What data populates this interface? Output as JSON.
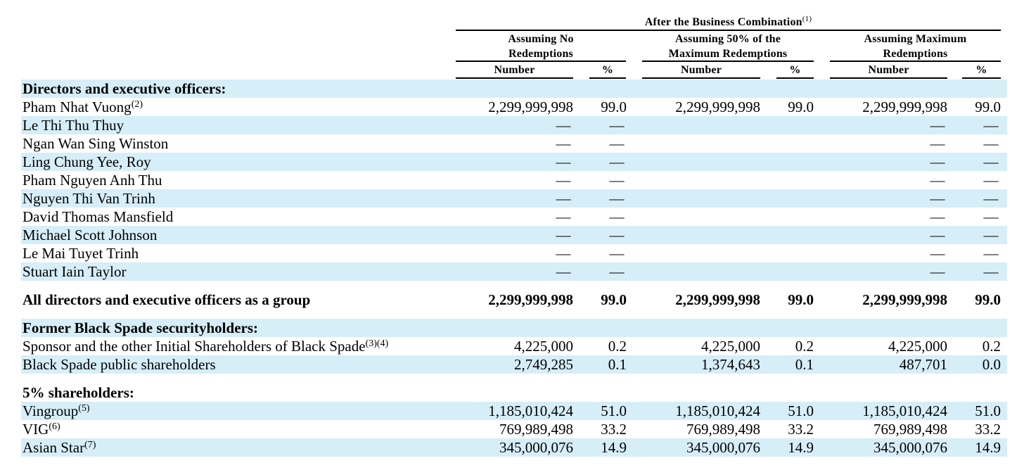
{
  "table": {
    "super_header": "After the Business Combination",
    "super_header_note": "(1)",
    "groups": [
      {
        "title_line1": "Assuming No",
        "title_line2": "Redemptions",
        "number_label": "Number",
        "pct_label": "%"
      },
      {
        "title_line1": "Assuming 50% of the",
        "title_line2": "Maximum Redemptions",
        "number_label": "Number",
        "pct_label": "%"
      },
      {
        "title_line1": "Assuming Maximum",
        "title_line2": "Redemptions",
        "number_label": "Number",
        "pct_label": "%"
      }
    ],
    "rows": [
      {
        "label": "Directors and executive officers:",
        "note": "",
        "values": [
          "",
          "",
          "",
          "",
          "",
          ""
        ]
      },
      {
        "label": "Pham Nhat Vuong",
        "note": "(2)",
        "values": [
          "2,299,999,998",
          "99.0",
          "2,299,999,998",
          "99.0",
          "2,299,999,998",
          "99.0"
        ]
      },
      {
        "label": "Le Thi Thu Thuy",
        "note": "",
        "values": [
          "—",
          "—",
          "",
          "",
          "—",
          "—"
        ]
      },
      {
        "label": "Ngan Wan Sing Winston",
        "note": "",
        "values": [
          "—",
          "—",
          "",
          "",
          "—",
          "—"
        ]
      },
      {
        "label": "Ling Chung Yee, Roy",
        "note": "",
        "values": [
          "—",
          "—",
          "",
          "",
          "—",
          "—"
        ]
      },
      {
        "label": "Pham Nguyen Anh Thu",
        "note": "",
        "values": [
          "—",
          "—",
          "",
          "",
          "—",
          "—"
        ]
      },
      {
        "label": "Nguyen Thi Van Trinh",
        "note": "",
        "values": [
          "—",
          "—",
          "",
          "",
          "—",
          "—"
        ]
      },
      {
        "label": "David Thomas Mansfield",
        "note": "",
        "values": [
          "—",
          "—",
          "",
          "",
          "—",
          "—"
        ]
      },
      {
        "label": "Michael Scott Johnson",
        "note": "",
        "values": [
          "—",
          "—",
          "",
          "",
          "—",
          "—"
        ]
      },
      {
        "label": "Le Mai Tuyet Trinh",
        "note": "",
        "values": [
          "—",
          "—",
          "",
          "",
          "—",
          "—"
        ]
      },
      {
        "label": "Stuart Iain Taylor",
        "note": "",
        "values": [
          "—",
          "—",
          "",
          "",
          "—",
          "—"
        ]
      },
      {
        "label": "All directors and executive officers as a group",
        "note": "",
        "values": [
          "2,299,999,998",
          "99.0",
          "2,299,999,998",
          "99.0",
          "2,299,999,998",
          "99.0"
        ]
      },
      {
        "label": "Former Black Spade securityholders:",
        "note": "",
        "values": [
          "",
          "",
          "",
          "",
          "",
          ""
        ]
      },
      {
        "label": "Sponsor and the other Initial Shareholders of Black Spade",
        "note": "(3)(4)",
        "values": [
          "4,225,000",
          "0.2",
          "4,225,000",
          "0.2",
          "4,225,000",
          "0.2"
        ]
      },
      {
        "label": "Black Spade public shareholders",
        "note": "",
        "values": [
          "2,749,285",
          "0.1",
          "1,374,643",
          "0.1",
          "487,701",
          "0.0"
        ]
      },
      {
        "label": "5% shareholders:",
        "note": "",
        "values": [
          "",
          "",
          "",
          "",
          "",
          ""
        ]
      },
      {
        "label": "Vingroup",
        "note": "(5)",
        "values": [
          "1,185,010,424",
          "51.0",
          "1,185,010,424",
          "51.0",
          "1,185,010,424",
          "51.0"
        ]
      },
      {
        "label": "VIG",
        "note": "(6)",
        "values": [
          "769,989,498",
          "33.2",
          "769,989,498",
          "33.2",
          "769,989,498",
          "33.2"
        ]
      },
      {
        "label": "Asian Star",
        "note": "(7)",
        "values": [
          "345,000,076",
          "14.9",
          "345,000,076",
          "14.9",
          "345,000,076",
          "14.9"
        ]
      }
    ]
  }
}
